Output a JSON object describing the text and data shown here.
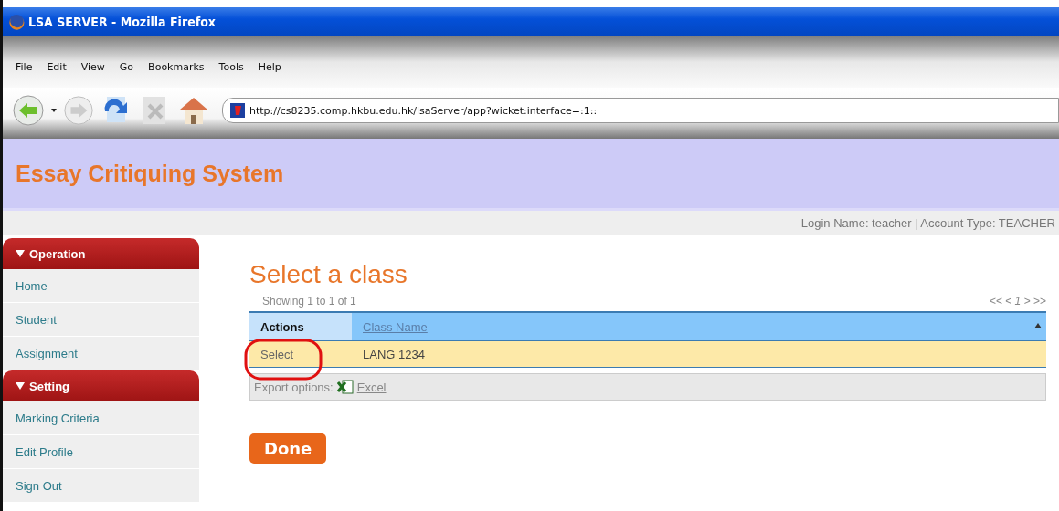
{
  "window": {
    "title": "LSA SERVER - Mozilla Firefox"
  },
  "menu": [
    "File",
    "Edit",
    "View",
    "Go",
    "Bookmarks",
    "Tools",
    "Help"
  ],
  "address_bar": {
    "value": "http://cs8235.comp.hkbu.edu.hk/lsaServer/app?wicket:interface=:1::"
  },
  "site": {
    "title": "Essay Critiquing System",
    "user_info": "Login Name: teacher | Account Type: TEACHER"
  },
  "sidebar": [
    {
      "heading": "Operation",
      "expanded": true,
      "items": [
        "Home",
        "Student",
        "Assignment"
      ]
    },
    {
      "heading": "Setting",
      "expanded": true,
      "items": [
        "Marking Criteria",
        "Edit Profile",
        "Sign Out"
      ]
    }
  ],
  "main": {
    "heading": "Select a class",
    "showing": "Showing 1 to 1 of 1",
    "pager": "<< < *1* > >>",
    "table": {
      "columns": [
        {
          "label": "Actions",
          "sortable": false
        },
        {
          "label": "Class Name",
          "sortable": true
        }
      ],
      "rows": [
        {
          "action": "Select",
          "class_name": "LANG 1234",
          "highlighted": true
        }
      ]
    },
    "export": {
      "label": "Export options:",
      "link": "Excel"
    },
    "button": "Done"
  }
}
